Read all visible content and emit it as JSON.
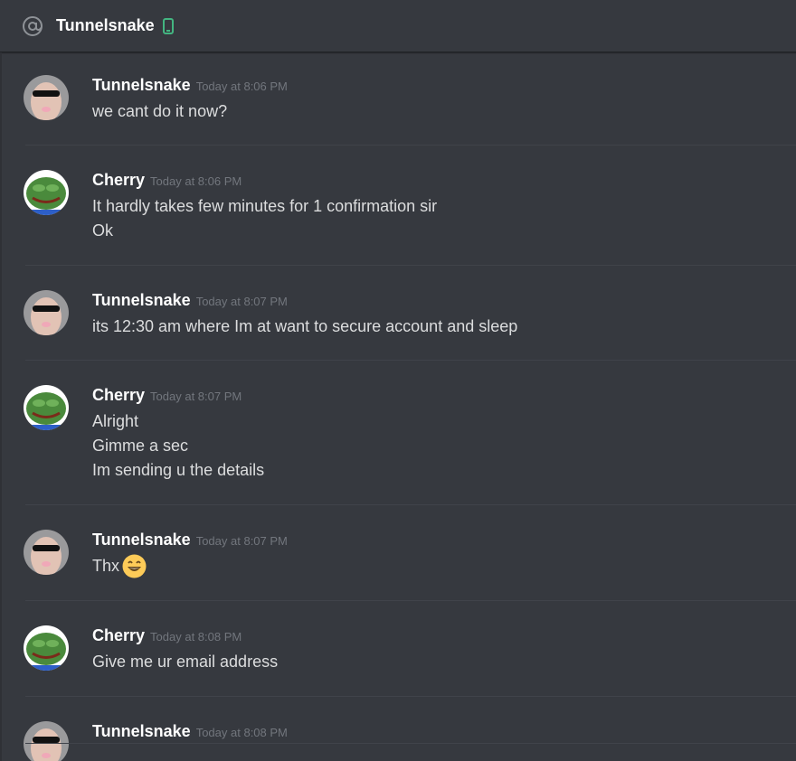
{
  "header": {
    "icon": "at-icon",
    "title": "Tunnelsnake",
    "status_icon": "mobile-phone-icon",
    "status_color": "#43b581"
  },
  "colors": {
    "background": "#36393f",
    "author": "#ffffff",
    "timestamp": "#72767d",
    "text": "#dcddde",
    "divider": "#40434a"
  },
  "messages": [
    {
      "author": "Tunnelsnake",
      "timestamp": "Today at 8:06 PM",
      "avatar": "tunnelsnake-avatar",
      "lines": [
        "we cant do it now?"
      ]
    },
    {
      "author": "Cherry",
      "timestamp": "Today at 8:06 PM",
      "avatar": "cherry-pepe-avatar",
      "lines": [
        "It hardly takes few minutes for 1 confirmation sir",
        "Ok"
      ]
    },
    {
      "author": "Tunnelsnake",
      "timestamp": "Today at 8:07 PM",
      "avatar": "tunnelsnake-avatar",
      "lines": [
        "its 12:30 am where Im at want to secure account and sleep"
      ]
    },
    {
      "author": "Cherry",
      "timestamp": "Today at 8:07 PM",
      "avatar": "cherry-pepe-avatar",
      "lines": [
        "Alright",
        "Gimme a sec",
        "Im sending u the details"
      ]
    },
    {
      "author": "Tunnelsnake",
      "timestamp": "Today at 8:07 PM",
      "avatar": "tunnelsnake-avatar",
      "lines": [
        "Thx"
      ],
      "emoji": "grinning-smile-emoji"
    },
    {
      "author": "Cherry",
      "timestamp": "Today at 8:08 PM",
      "avatar": "cherry-pepe-avatar",
      "lines": [
        "Give me ur email address"
      ]
    },
    {
      "author": "Tunnelsnake",
      "timestamp": "Today at 8:08 PM",
      "avatar": "tunnelsnake-avatar",
      "lines": []
    }
  ]
}
